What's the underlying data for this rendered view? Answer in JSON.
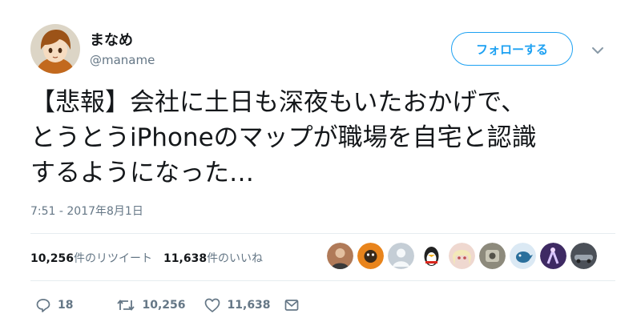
{
  "user": {
    "display_name": "まなめ",
    "handle": "@maname",
    "avatar_icon": "anime-character-avatar-icon"
  },
  "follow_button_label": "フォローする",
  "tweet": {
    "lines": [
      "【悲報】会社に土日も深夜もいたおかげで、",
      "とうとうiPhoneのマップが職場を自宅と認識",
      "するようになった…"
    ],
    "timestamp": "7:51 - 2017年8月1日"
  },
  "stats": {
    "retweet_count": "10,256",
    "retweet_label": "件のリツイート",
    "like_count": "11,638",
    "like_label": "件のいいね"
  },
  "likers": [
    {
      "icon": "photo-avatar-icon",
      "color": "#b07a58"
    },
    {
      "icon": "orange-character-avatar-icon",
      "color": "#e8841c"
    },
    {
      "icon": "default-egg-avatar-icon",
      "color": "#c5ced6"
    },
    {
      "icon": "penguin-avatar-icon",
      "color": "#222222"
    },
    {
      "icon": "anime-girl-avatar-icon",
      "color": "#efd8d0"
    },
    {
      "icon": "photo-avatar-icon",
      "color": "#8d8a7c"
    },
    {
      "icon": "bird-avatar-icon",
      "color": "#2a6f9c"
    },
    {
      "icon": "purple-dancer-avatar-icon",
      "color": "#3e2a63"
    },
    {
      "icon": "car-avatar-icon",
      "color": "#4b5058"
    }
  ],
  "actions": {
    "reply_count": "18",
    "retweet_count": "10,256",
    "like_count": "11,638"
  },
  "colors": {
    "accent": "#1da1f2",
    "text": "#14171a",
    "secondary_text": "#657786",
    "divider": "#e6ecf0"
  }
}
